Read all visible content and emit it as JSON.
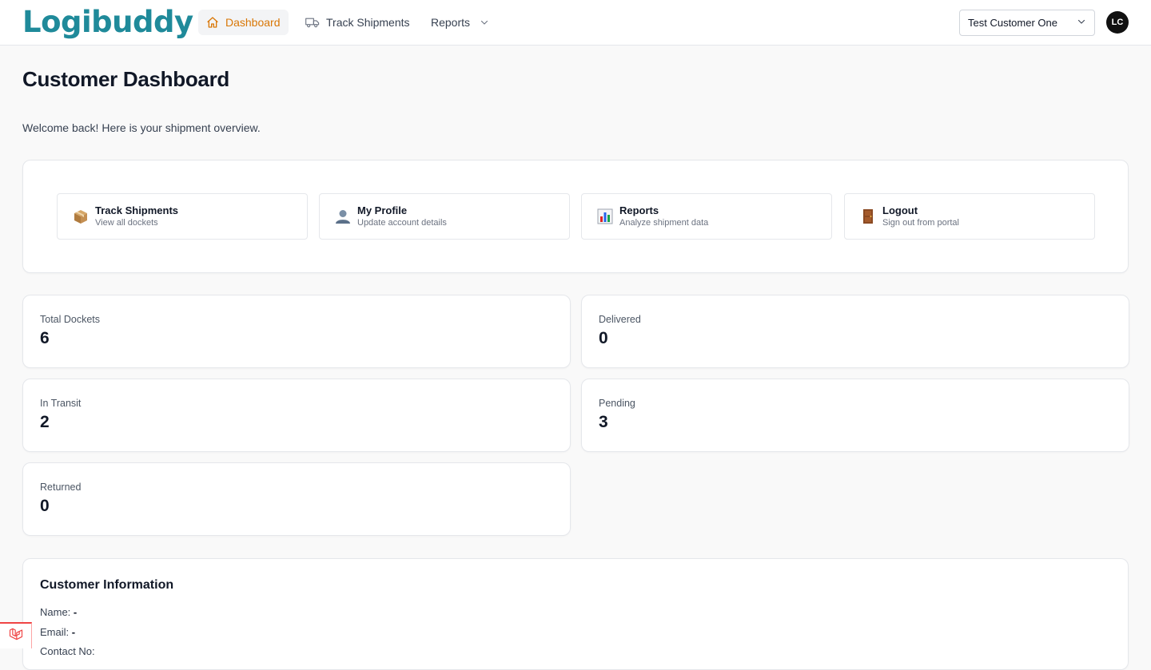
{
  "brand": {
    "name_left": "Logibuddy",
    "accent": "#1f8a9a",
    "dot_color": "#e23b3b"
  },
  "nav": {
    "dashboard": "Dashboard",
    "track": "Track Shipments",
    "reports": "Reports",
    "active_color": "#d97706"
  },
  "customer_select": {
    "value": "Test Customer One"
  },
  "user": {
    "initials": "LC"
  },
  "header": {
    "title": "Customer Dashboard",
    "welcome": "Welcome back! Here is your shipment overview."
  },
  "quick_links": [
    {
      "title": "Track Shipments",
      "subtitle": "View all dockets",
      "icon": "package-icon"
    },
    {
      "title": "My Profile",
      "subtitle": "Update account details",
      "icon": "profile-icon"
    },
    {
      "title": "Reports",
      "subtitle": "Analyze shipment data",
      "icon": "bar-chart-icon"
    },
    {
      "title": "Logout",
      "subtitle": "Sign out from portal",
      "icon": "door-icon"
    }
  ],
  "stats": {
    "total": {
      "label": "Total Dockets",
      "value": "6"
    },
    "delivered": {
      "label": "Delivered",
      "value": "0"
    },
    "in_transit": {
      "label": "In Transit",
      "value": "2"
    },
    "pending": {
      "label": "Pending",
      "value": "3"
    },
    "returned": {
      "label": "Returned",
      "value": "0"
    }
  },
  "customer_info": {
    "title": "Customer Information",
    "name_label": "Name:",
    "name_value": "-",
    "email_label": "Email:",
    "email_value": "-",
    "third_label": "Contact No:"
  }
}
